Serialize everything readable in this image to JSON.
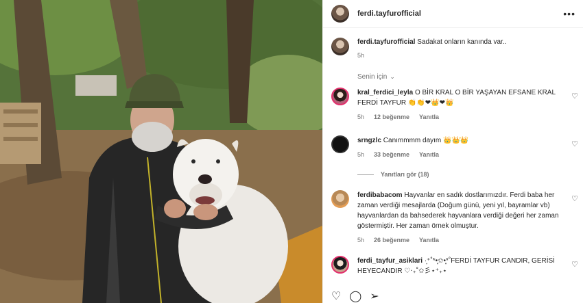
{
  "post": {
    "username": "ferdi.tayfurofficial",
    "more_icon": "more-horizontal-icon",
    "caption": {
      "username": "ferdi.tayfurofficial",
      "text": "Sadakat onların kanında var..",
      "time": "5h"
    }
  },
  "sort_label": "Senin için",
  "comments": [
    {
      "username": "kral_ferdici_leyla",
      "text": "O BİR KRAL O BİR YAŞAYAN EFSANE KRAL FERDİ TAYFUR 👏👏❤👑❤👑",
      "time": "5h",
      "likes": "12 beğenme",
      "reply": "Yanıtla"
    },
    {
      "username": "srngzlc",
      "text": "Canımmmm dayım 👑👑👑",
      "time": "5h",
      "likes": "33 beğenme",
      "reply": "Yanıtla"
    },
    {
      "username": "ferdibabacom",
      "text": "Hayvanlar en sadık dostlarımızdır. Ferdi baba her zaman verdiği mesajlarda (Doğum günü, yeni yıl, bayramlar vb) hayvanlardan da bahsederek hayvanlara verdiği değeri her zaman göstermiştir. Her zaman örnek olmuştur.",
      "time": "5h",
      "likes": "26 beğenme",
      "reply": "Yanıtla"
    },
    {
      "username": "ferdi_tayfur_asiklari",
      "text": "·͙⁺˚*•̩̩͙✩•̩̩͙*˚FERDİ TAYFUR CANDIR, GERİSİ HEYECANDIR ♡‧₊˚✩彡⋆⁺₊⋆"
    }
  ],
  "view_replies": "Yanıtları gör (18)",
  "actions": [
    "heart-icon",
    "comment-icon",
    "share-icon"
  ],
  "colors": {
    "muted": "#737373",
    "text": "#262626",
    "border": "#efefef"
  }
}
